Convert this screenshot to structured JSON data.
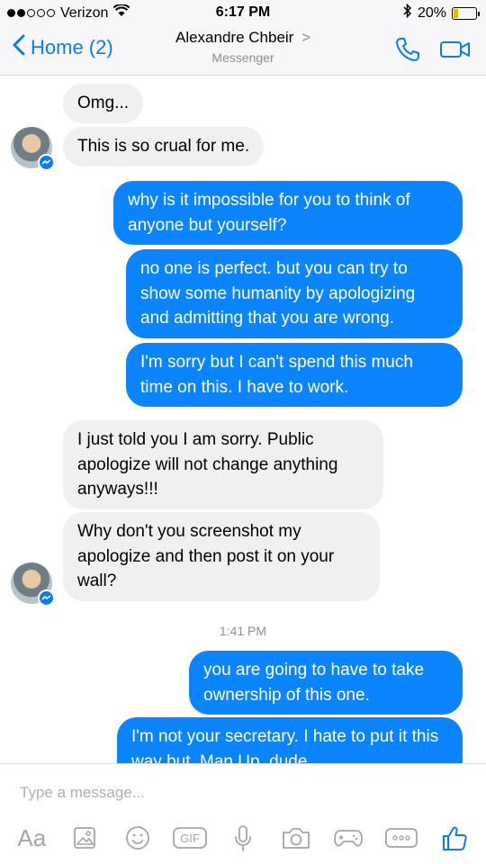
{
  "status_bar": {
    "carrier": "Verizon",
    "time": "6:17 PM",
    "battery": "20%",
    "battery_level": 0.2
  },
  "nav": {
    "back_label": "Home (2)",
    "contact_name": "Alexandre Chbeir",
    "contact_chevron": ">",
    "subtitle": "Messenger",
    "icons": [
      "chevron-left-icon",
      "phone-icon",
      "video-camera-icon"
    ]
  },
  "messages": [
    {
      "side": "in",
      "text": "Omg..."
    },
    {
      "side": "in",
      "text": "This is so crual for me."
    },
    {
      "side": "out",
      "text": "why is it impossible for you to think of anyone but yourself?"
    },
    {
      "side": "out",
      "text": "no one is perfect.  but you can try to show some humanity by apologizing and admitting that you are wrong."
    },
    {
      "side": "out",
      "text": "I'm sorry but I can't spend this much time on this.  I have to work."
    },
    {
      "side": "in",
      "text": "I just told you I am sorry. Public apologize will not change anything anyways!!!"
    },
    {
      "side": "in",
      "text": "Why don't you screenshot my apologize and then post it on your wall?"
    },
    {
      "side": "out",
      "text": "you are going to have to take ownership of this one."
    },
    {
      "side": "out",
      "text": "I'm not your secretary.  I hate to put it this way but. Man Up, dude."
    }
  ],
  "timestamp": "1:41 PM",
  "composer": {
    "placeholder": "Type a message...",
    "aa_label": "Aa",
    "gif_label": "GIF",
    "tools": [
      "text-format-icon",
      "image-icon",
      "emoji-icon",
      "gif-icon",
      "microphone-icon",
      "camera-icon",
      "game-controller-icon",
      "more-icon",
      "thumbs-up-icon"
    ]
  },
  "colors": {
    "accent": "#0a7cf0",
    "outgoing_bubble": "#0b84ff",
    "incoming_bubble": "#f0f0f0",
    "bar_background": "#f7f7f9"
  }
}
